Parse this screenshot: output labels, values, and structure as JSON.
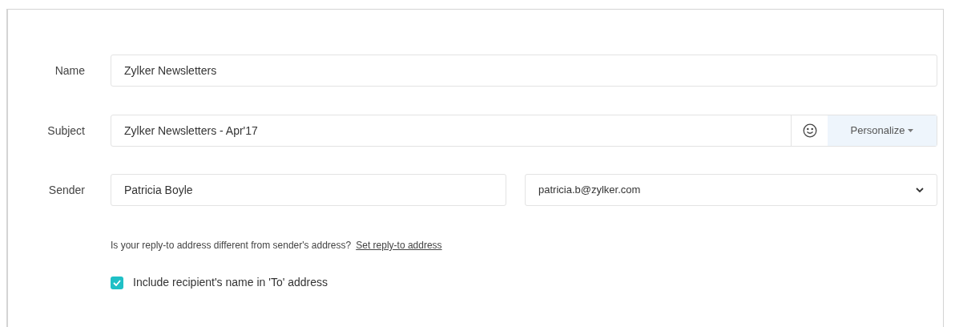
{
  "fields": [
    {
      "label": "Name",
      "value": "Zylker Newsletters"
    },
    {
      "label": "Subject",
      "value": "Zylker Newsletters - Apr'17",
      "personalize": "Personalize"
    }
  ],
  "sender": {
    "label": "Sender",
    "name": "Patricia Boyle",
    "email": "patricia.b@zylker.com"
  },
  "reply_to": {
    "question": "Is your reply-to address different from sender's address?",
    "link": "Set reply-to address"
  },
  "include_name": {
    "label": "Include recipient's name in 'To' address",
    "checked": true
  }
}
